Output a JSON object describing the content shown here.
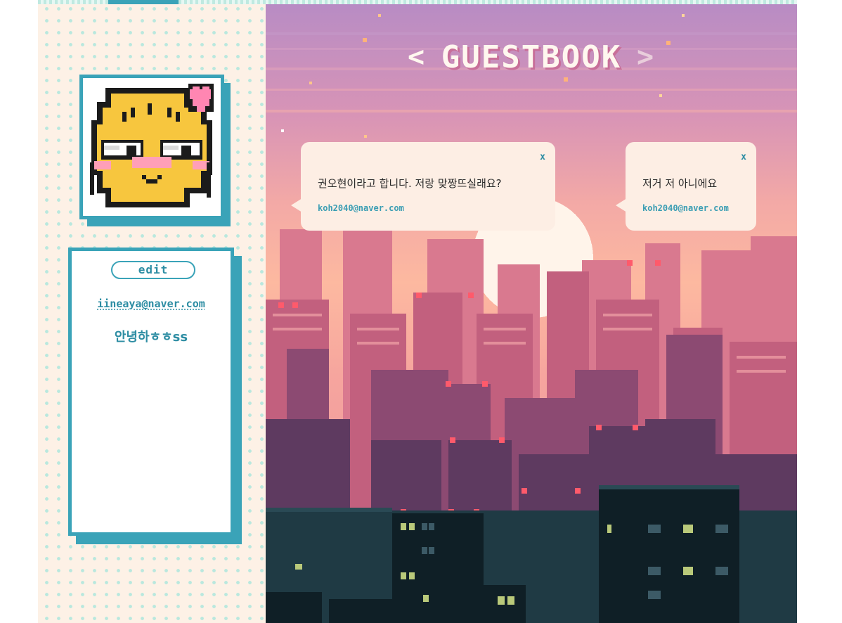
{
  "sidebar": {
    "edit_label": "edit",
    "email": "iineaya@naver.com",
    "bio": "안녕하ㅎㅎss"
  },
  "guestbook": {
    "title": "GUESTBOOK",
    "prev_arrow": "<",
    "next_arrow": ">",
    "entries": [
      {
        "message": "권오현이라고 합니다. 저랑 맞짱뜨실래요?",
        "author": "koh2040@naver.com",
        "close_label": "x"
      },
      {
        "message": "저거 저 아니에요",
        "author": "koh2040@naver.com",
        "close_label": "x"
      }
    ]
  },
  "colors": {
    "accent": "#3aa3b8",
    "sidebar_bg": "#fdf1e6",
    "dots": "#b9e8de",
    "bubble_bg": "#fdeee4",
    "text_teal": "#2d8da3"
  },
  "icons": {
    "avatar": "pixel-emoji-face-with-heart-icon",
    "close": "x-icon",
    "prev": "chevron-left-icon",
    "next": "chevron-right-icon"
  }
}
